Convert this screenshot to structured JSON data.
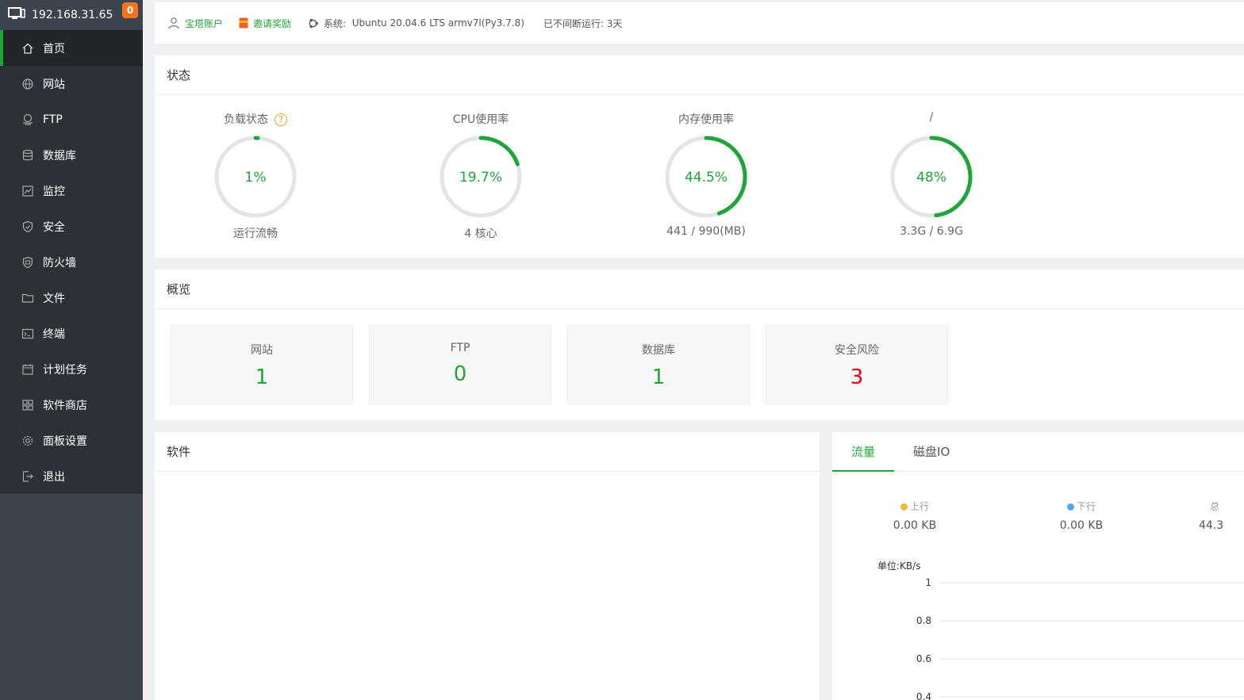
{
  "sidebar": {
    "ip": "192.168.31.65",
    "badge": "0",
    "items": [
      {
        "label": "首页",
        "icon": "home-icon"
      },
      {
        "label": "网站",
        "icon": "globe-icon"
      },
      {
        "label": "FTP",
        "icon": "ftp-icon"
      },
      {
        "label": "数据库",
        "icon": "database-icon"
      },
      {
        "label": "监控",
        "icon": "monitor-icon"
      },
      {
        "label": "安全",
        "icon": "shield-icon"
      },
      {
        "label": "防火墙",
        "icon": "firewall-icon"
      },
      {
        "label": "文件",
        "icon": "folder-icon"
      },
      {
        "label": "终端",
        "icon": "terminal-icon"
      },
      {
        "label": "计划任务",
        "icon": "calendar-icon"
      },
      {
        "label": "软件商店",
        "icon": "grid-icon"
      },
      {
        "label": "面板设置",
        "icon": "gear-icon"
      },
      {
        "label": "退出",
        "icon": "logout-icon"
      }
    ]
  },
  "topbar": {
    "account": "宝塔账户",
    "invite": "邀请奖励",
    "system_label": "系统:",
    "system_value": "Ubuntu 20.04.6 LTS armv7l(Py3.7.8)",
    "uptime": "已不间断运行: 3天"
  },
  "status": {
    "title": "状态",
    "gauges": [
      {
        "label": "负载状态",
        "value": "1%",
        "percent": 1,
        "sub": "运行流畅",
        "help": "?"
      },
      {
        "label": "CPU使用率",
        "value": "19.7%",
        "percent": 19.7,
        "sub": "4 核心"
      },
      {
        "label": "内存使用率",
        "value": "44.5%",
        "percent": 44.5,
        "sub": "441 / 990(MB)"
      },
      {
        "label": "/",
        "value": "48%",
        "percent": 48,
        "sub": "3.3G / 6.9G"
      }
    ],
    "colors": {
      "accent": "#20a53a",
      "track": "#e4e4e4"
    }
  },
  "overview": {
    "title": "概览",
    "cards": [
      {
        "label": "网站",
        "value": "1"
      },
      {
        "label": "FTP",
        "value": "0"
      },
      {
        "label": "数据库",
        "value": "1"
      },
      {
        "label": "安全风险",
        "value": "3",
        "color": "#e4000f"
      }
    ]
  },
  "software": {
    "title": "软件"
  },
  "traffic": {
    "tabs": [
      "流量",
      "磁盘IO"
    ],
    "up_label": "上行",
    "up_value": "0.00 KB",
    "up_color": "#f0b840",
    "down_label": "下行",
    "down_value": "0.00 KB",
    "down_color": "#52a9ff",
    "total_label": "总",
    "total_value": "44.3",
    "unit": "单位:KB/s",
    "chart_data": {
      "type": "line",
      "ylabel": "单位:KB/s",
      "yticks": [
        "1",
        "0.8",
        "0.6",
        "0.4"
      ],
      "ylim": [
        0.4,
        1
      ],
      "grid": true,
      "series": []
    }
  }
}
